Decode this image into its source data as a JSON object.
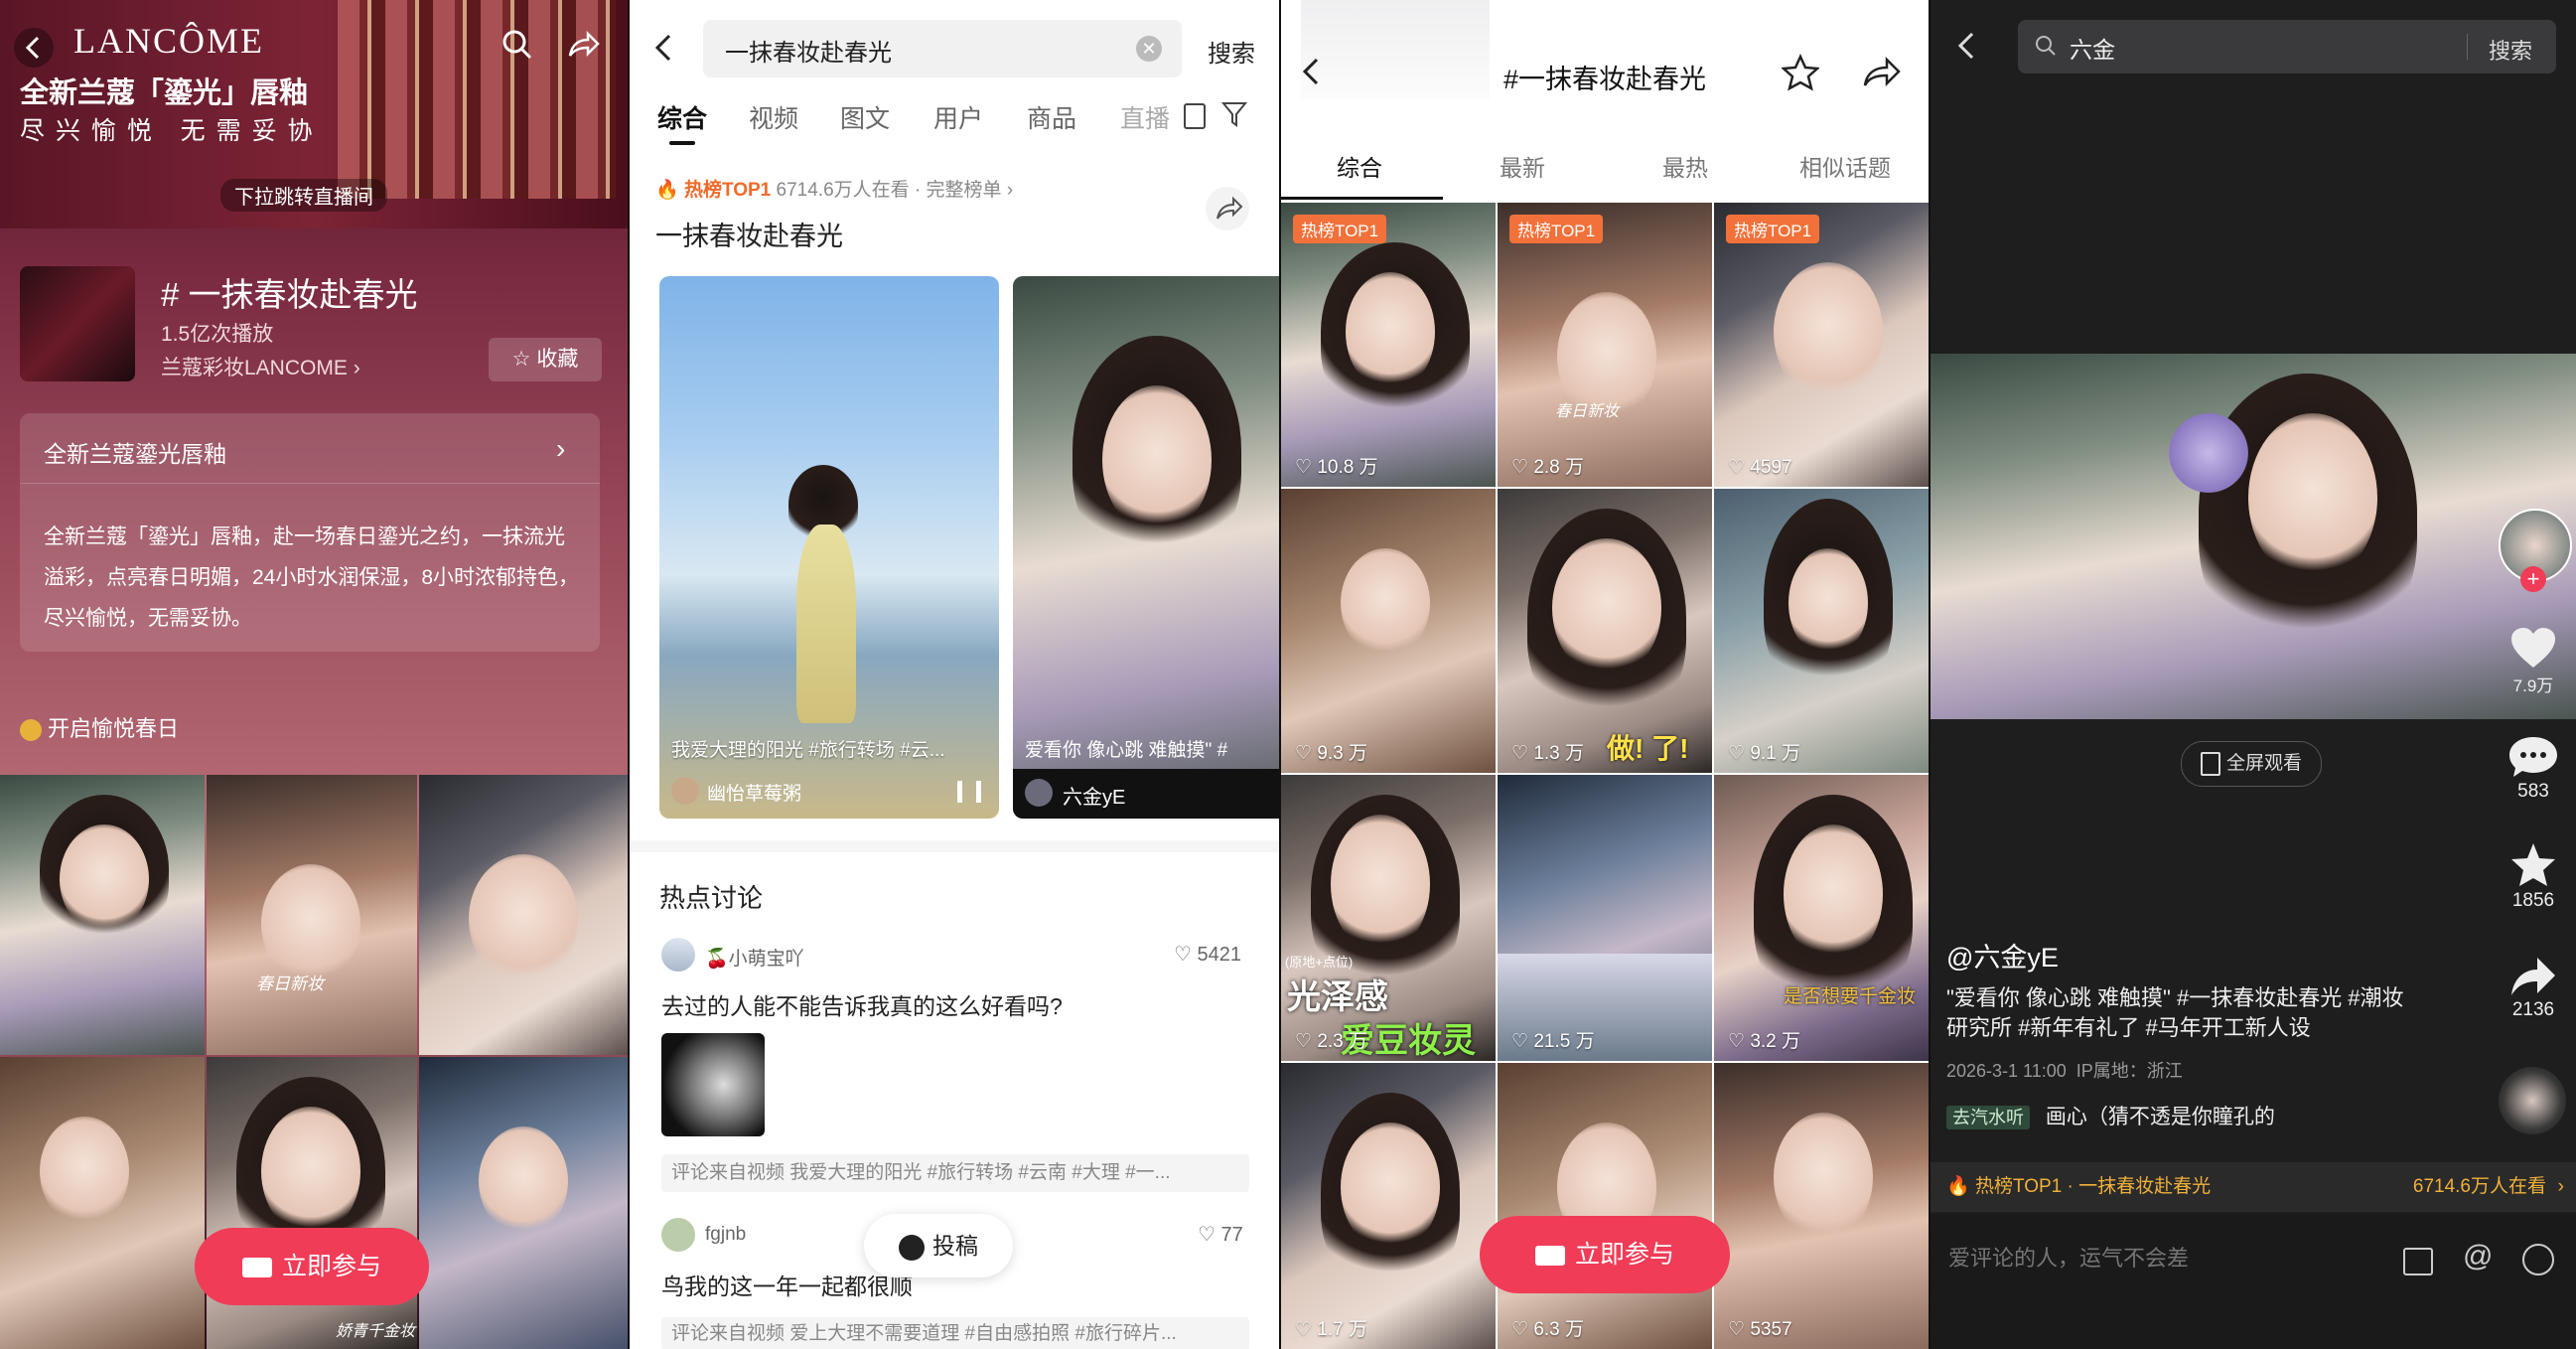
{
  "p1": {
    "ad_brand": "LANCÔME",
    "ad_title": "全新兰蔻「鎏光」唇釉",
    "ad_sub": "尽 兴 愉 悦   无 需 妥 协",
    "ad_pull": "下拉跳转直播间",
    "topic_title": "# 一抹春妆赴春光",
    "plays": "1.5亿次播放",
    "brand_link": "兰蔻彩妆LANCOME",
    "fav_label": "收藏",
    "card_title": "全新兰蔻鎏光唇釉",
    "card_desc": "全新兰蔻「鎏光」唇釉，赴一场春日鎏光之约，一抹流光溢彩，点亮春日明媚，24小时水润保湿，8小时浓郁持色，尽兴愉悦，无需妥协。",
    "spring_link": "开启愉悦春日",
    "join_label": "立即参与",
    "grid_caption_1": "春日新妆",
    "grid_caption_2": "娇青千金妆"
  },
  "p2": {
    "search_value": "一抹春妆赴春光",
    "search_btn": "搜索",
    "tabs": [
      "综合",
      "视频",
      "图文",
      "用户",
      "商品",
      "直播"
    ],
    "hot_label": "热榜TOP1",
    "hot_views": "6714.6万人在看",
    "hot_board": "· 完整榜单",
    "topic_heading": "一抹春妆赴春光",
    "v1_caption": "我爱大理的阳光 #旅行转场 #云...",
    "v1_author": "幽怡草莓粥",
    "v2_caption": "爱看你 像心跳 难触摸\" #",
    "v2_author": "六金yE",
    "discuss_title": "热点讨论",
    "d1_user": "🍒小萌宝吖",
    "d1_likes": "5421",
    "d1_text": "去过的人能不能告诉我真的这么好看吗?",
    "d1_from": "评论来自视频  我爱大理的阳光 #旅行转场 #云南 #大理 #一...",
    "d2_user": "fgjnb",
    "d2_likes": "77",
    "d2_text": "鸟我的这一年一起都很顺",
    "d2_from": "评论来自视频  爱上大理不需要道理 #自由感拍照 #旅行碎片...",
    "post_label": "投稿"
  },
  "p3": {
    "title": "#一抹春妆赴春光",
    "tabs": [
      "综合",
      "最新",
      "最热",
      "相似话题"
    ],
    "hot_badge": "热榜TOP1",
    "likes": [
      "10.8 万",
      "2.8 万",
      "4597",
      "9.3 万",
      "1.3 万",
      "9.1 万",
      "2.3 万",
      "21.5 万",
      "3.2 万",
      "1.7 万",
      "6.3 万",
      "5357"
    ],
    "overlay_1": "春日新妆",
    "overlay_2": "做! 了!",
    "overlay_3": "(原地+点位)",
    "overlay_4": "光泽感",
    "overlay_5": "爱豆妆灵魂",
    "overlay_6": "是否想要千金妆",
    "join_label": "立即参与"
  },
  "p4": {
    "search_value": "六金",
    "search_btn": "搜索",
    "fullscreen": "全屏观看",
    "like_count": "7.9万",
    "comment_count": "583",
    "fav_count": "1856",
    "share_count": "2136",
    "author": "@六金yE",
    "desc": "\"爱看你 像心跳 难触摸\" #一抹春妆赴春光 #潮妆研究所 #新年有礼了 #马年开工新人设",
    "meta": "2026-3-1 11:00  IP属地：浙江",
    "music_tag": "去汽水听",
    "music_text": "画心（猜不透是你瞳孔的",
    "hot_bar": "热榜TOP1 · 一抹春妆赴春光",
    "hot_views": "6714.6万人在看",
    "comment_placeholder": "爱评论的人，运气不会差"
  }
}
